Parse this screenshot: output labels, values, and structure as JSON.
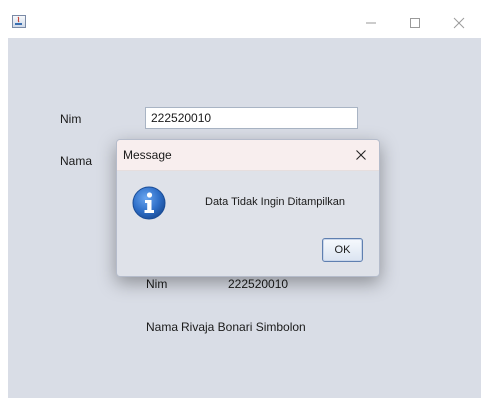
{
  "form": {
    "nim_label": "Nim",
    "nim_value": "222520010",
    "nama_label": "Nama"
  },
  "output": {
    "nim_label": "Nim",
    "nim_value": "222520010",
    "nama_label": "Nama",
    "nama_value": "Rivaja Bonari Simbolon"
  },
  "dialog": {
    "title": "Message",
    "message": "Data Tidak Ingin Ditampilkan",
    "ok_label": "OK",
    "icon": "info-icon"
  },
  "window_controls": {
    "icons": [
      "minimize-icon",
      "maximize-icon",
      "close-icon"
    ]
  },
  "colors": {
    "window_bg": "#d9dde6",
    "dialog_titlebar": "#f8eeee",
    "info_icon": "#2f6fc8",
    "ok_border": "#5f7fb0"
  }
}
